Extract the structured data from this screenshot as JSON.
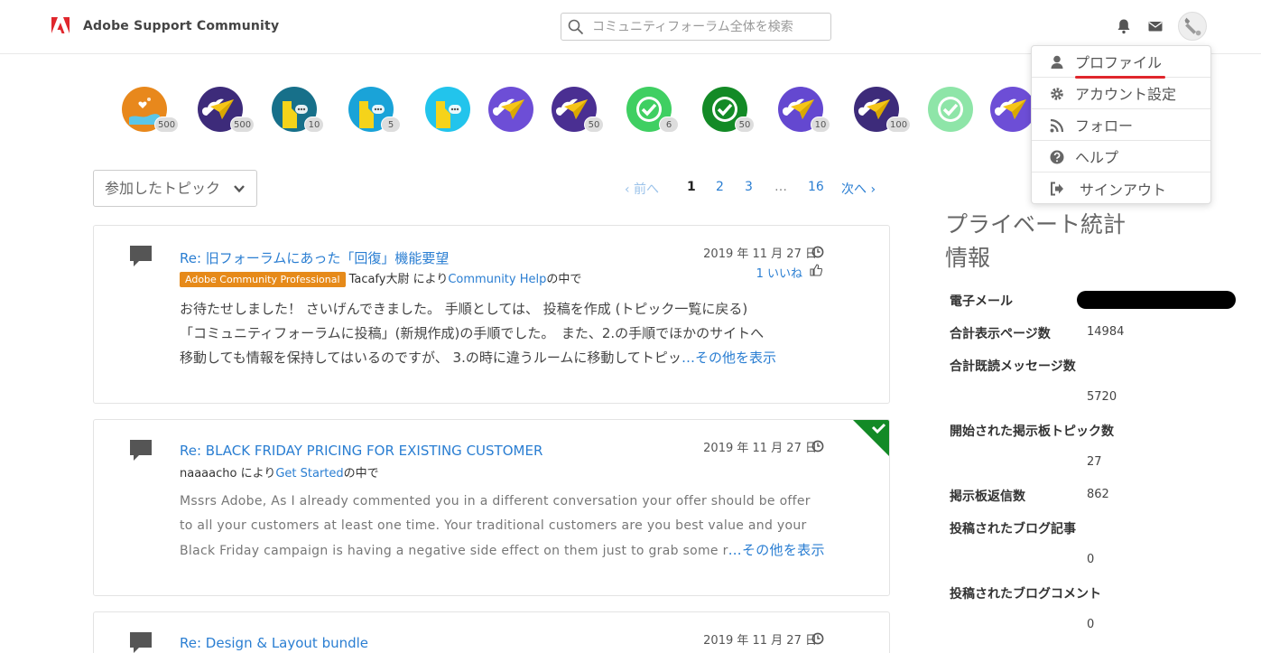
{
  "header": {
    "brand": "Adobe Support Community",
    "search_placeholder": "コミュニティフォーラム全体を検索",
    "icons": [
      "adobe-logo-icon",
      "search-icon",
      "bell-icon",
      "envelope-icon",
      "user-avatar"
    ]
  },
  "user_menu": {
    "items": [
      {
        "label": "プロファイル",
        "icon": "user-icon"
      },
      {
        "label": "アカウント設定",
        "icon": "gear-icon"
      },
      {
        "label": "フォロー",
        "icon": "rss-icon"
      },
      {
        "label": "ヘルプ",
        "icon": "question-icon"
      },
      {
        "label": "サインアウト",
        "icon": "sign-out-icon"
      }
    ]
  },
  "badges": [
    {
      "count": "500",
      "kind": "heart-hand",
      "color": "#e8881c"
    },
    {
      "count": "500",
      "kind": "plane",
      "color": "#3d2b7a"
    },
    {
      "count": "10",
      "kind": "speech",
      "color": "#17708a"
    },
    {
      "count": "5",
      "kind": "speech",
      "color": "#1aa3d8"
    },
    {
      "count": "",
      "kind": "speech",
      "color": "#22c4ec"
    },
    {
      "count": "",
      "kind": "plane",
      "color": "#6d4ed6"
    },
    {
      "count": "50",
      "kind": "plane",
      "color": "#4a2f92"
    },
    {
      "count": "6",
      "kind": "check",
      "color": "#3fcf62"
    },
    {
      "count": "50",
      "kind": "check",
      "color": "#138a26"
    },
    {
      "count": "10",
      "kind": "plane",
      "color": "#6448d0"
    },
    {
      "count": "100",
      "kind": "plane",
      "color": "#3d2b7a"
    },
    {
      "count": "",
      "kind": "check",
      "color": "#8ee5a8"
    },
    {
      "count": "",
      "kind": "plane",
      "color": "#6d4ed6"
    }
  ],
  "filter": {
    "label": "参加したトピック"
  },
  "pagination": {
    "prev": "‹ 前へ",
    "pages": [
      "1",
      "2",
      "3",
      "…",
      "16"
    ],
    "next": "次へ ›",
    "current": "1"
  },
  "posts": [
    {
      "title": "Re: 旧フォーラムにあった「回復」機能要望",
      "date": "2019 年 11 月 27 日",
      "rank": "Adobe Community Professional",
      "author": "Tacafy大尉",
      "by_text": " により",
      "board": "Community Help",
      "board_suffix": "の中で",
      "likes": "1 いいね",
      "body_lines": [
        "お待たせしました！ さいげんできました。 手順としては、 投稿を作成 (トピック一覧に戻る)",
        "「コミュニティフォーラムに投稿」(新規作成)の手順でした。　また、2.の手順でほかのサイトへ",
        "移動しても情報を保持してはいるのですが、 3.の時に違うルームに移動してトピッ"
      ],
      "more": "…その他を表示"
    },
    {
      "title": "Re: BLACK FRIDAY PRICING FOR EXISTING CUSTOMER",
      "date": "2019 年 11 月 27 日",
      "author": "naaaacho",
      "by_text": " により",
      "board": "Get Started",
      "board_suffix": "の中で",
      "body_lines": [
        "Mssrs Adobe,    As I already commented you in a different conversation your offer should be offer",
        "to all your customers at least one time. Your traditional customers are you best value and your",
        "Black Friday campaign is having a negative side effect on them just to grab some r"
      ],
      "more": "…その他を表示"
    },
    {
      "title": "Re: Design & Layout bundle",
      "date": "2019 年 11 月 27 日"
    }
  ],
  "stats": {
    "title": "プライベート統計情報",
    "rows": [
      {
        "label": "電子メール",
        "value": ""
      },
      {
        "label": "合計表示ページ数",
        "value": "14984"
      },
      {
        "label": "合計既読メッセージ数",
        "value": "5720"
      },
      {
        "label": "開始された掲示板トピック数",
        "value": "27"
      },
      {
        "label": "掲示板返信数",
        "value": "862"
      },
      {
        "label": "投稿されたブログ記事",
        "value": "0"
      },
      {
        "label": "投稿されたブログコメント",
        "value": "0"
      }
    ]
  },
  "colors": {
    "link": "#2a7ed2",
    "adobe_red": "#e0262c",
    "rank_orange": "#e68a1a",
    "solved_green": "#138a26"
  }
}
